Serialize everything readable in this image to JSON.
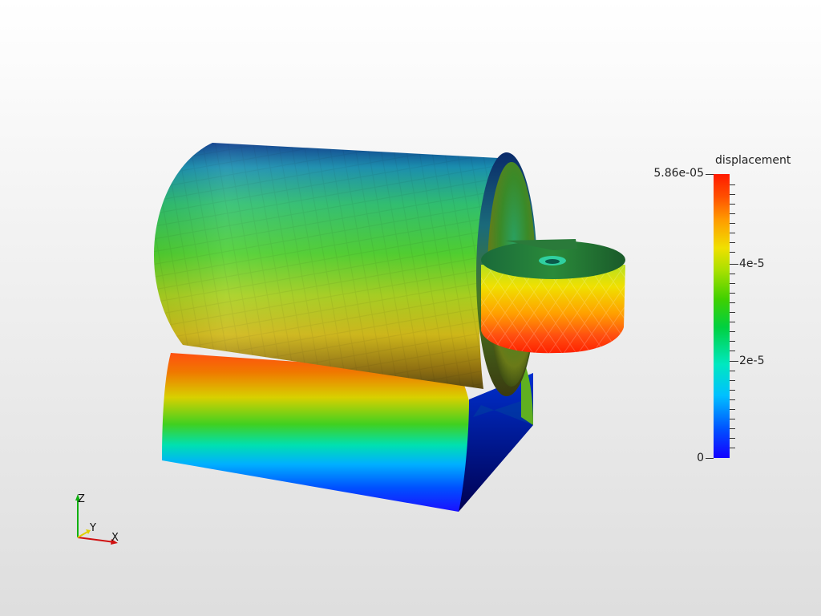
{
  "scene": {
    "field_name": "displacement",
    "legend": {
      "title": "displacement",
      "max_label": "5.86e-05",
      "min_label": "0",
      "tick_labels": [
        "4e-5",
        "2e-5"
      ],
      "colormap": [
        "#1400ff",
        "#00c0ff",
        "#00d040",
        "#f0e000",
        "#ff1a00"
      ]
    },
    "axes": {
      "x": "X",
      "y": "Y",
      "z": "Z",
      "x_color": "#d01010",
      "y_color": "#e0d000",
      "z_color": "#10b010"
    },
    "background": [
      "#ffffff",
      "#dedede"
    ]
  }
}
